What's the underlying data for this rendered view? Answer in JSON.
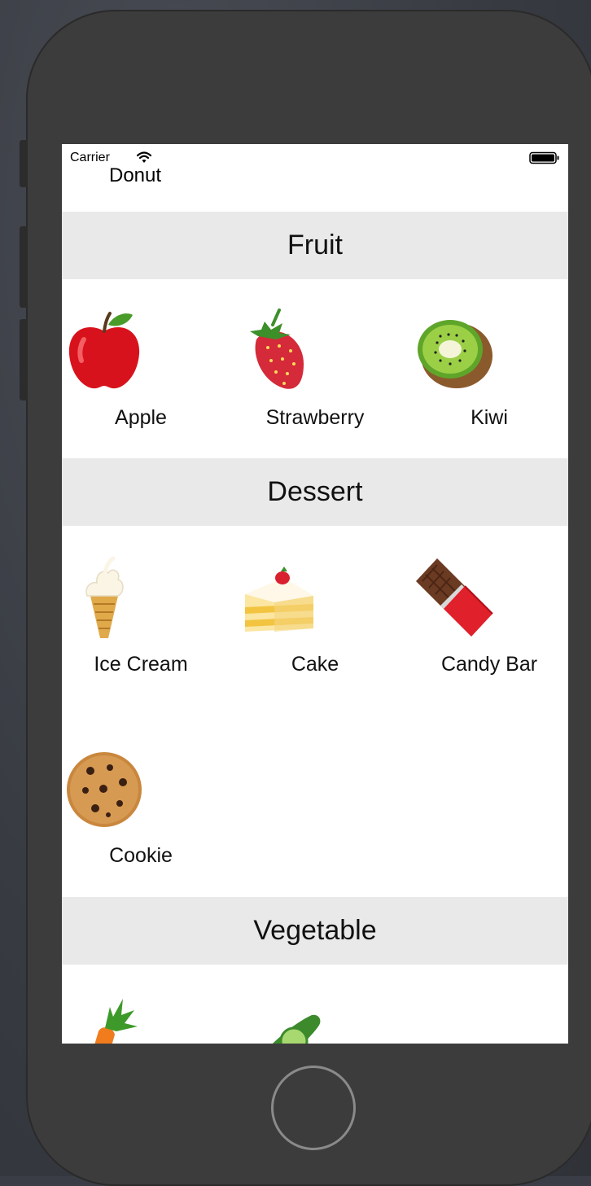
{
  "status_bar": {
    "carrier": "Carrier",
    "wifi_icon": "wifi-icon",
    "battery_icon": "battery-icon"
  },
  "floating_title": "Donut",
  "sections": [
    {
      "title": "Fruit",
      "items": [
        {
          "label": "Apple",
          "icon": "apple-icon"
        },
        {
          "label": "Strawberry",
          "icon": "strawberry-icon"
        },
        {
          "label": "Kiwi",
          "icon": "kiwi-icon"
        }
      ]
    },
    {
      "title": "Dessert",
      "items": [
        {
          "label": "Ice Cream",
          "icon": "ice-cream-icon"
        },
        {
          "label": "Cake",
          "icon": "cake-icon"
        },
        {
          "label": "Candy Bar",
          "icon": "candy-bar-icon"
        },
        {
          "label": "Cookie",
          "icon": "cookie-icon"
        }
      ]
    },
    {
      "title": "Vegetable",
      "items": [
        {
          "label": "",
          "icon": "carrot-icon"
        },
        {
          "label": "",
          "icon": "cucumber-icon"
        }
      ]
    }
  ],
  "home_button_icon": "home-button"
}
